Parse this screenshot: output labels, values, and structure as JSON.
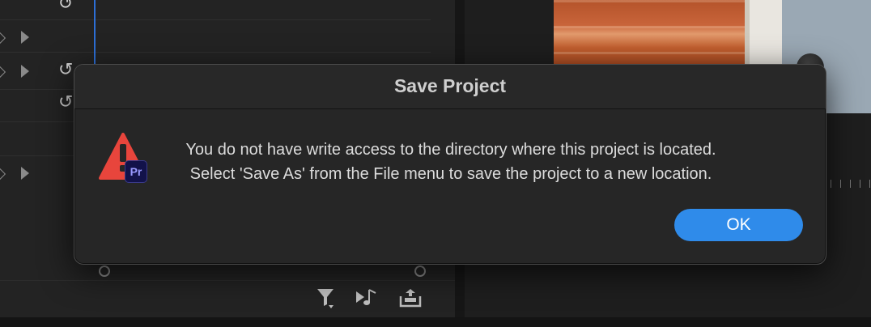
{
  "dialog": {
    "title": "Save Project",
    "message_line1": "You do not have write access to the directory where this project is located.",
    "message_line2": "Select 'Save As' from the File menu to save the project to a new location.",
    "ok_label": "OK",
    "icon": "warning-triangle-icon",
    "app_badge": "Pr"
  },
  "colors": {
    "accent": "#2f8bea",
    "warning": "#e8453c",
    "badge_bg": "#12124a",
    "badge_text": "#9a9aff"
  }
}
